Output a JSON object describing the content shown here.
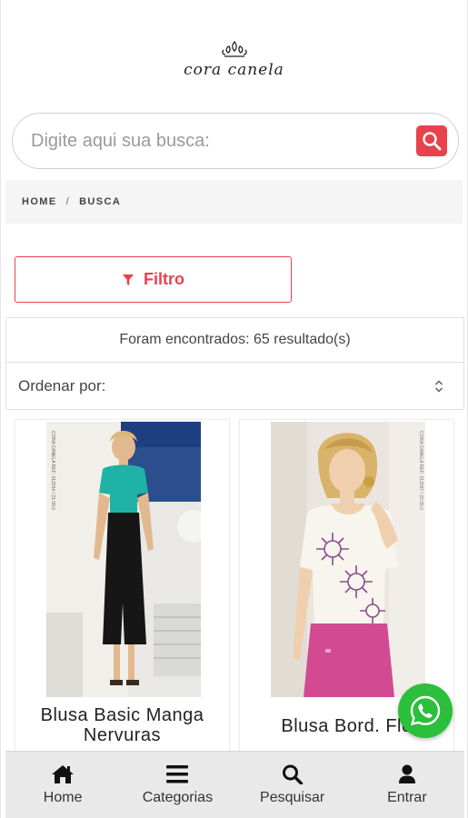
{
  "brand": {
    "logo_text": "cora canela"
  },
  "search": {
    "placeholder": "Digite aqui sua busca:"
  },
  "breadcrumb": {
    "home": "HOME",
    "separator": "/",
    "current": "BUSCA"
  },
  "filter": {
    "label": "Filtro"
  },
  "results": {
    "text": "Foram encontrados: 65 resultado(s)"
  },
  "sort": {
    "label": "Ordenar por:"
  },
  "products": [
    {
      "title": "Blusa Basic Manga Nervuras",
      "photo_caption": "CORA CANELA REF: 212034 / 21.08.0"
    },
    {
      "title": "Blusa Bord. Flo",
      "photo_caption": "CORA CANELA REF: 212097 / 22.05.0"
    }
  ],
  "bottom_nav": {
    "home": "Home",
    "categories": "Categorias",
    "search": "Pesquisar",
    "login": "Entrar"
  },
  "colors": {
    "accent": "#e8424c",
    "whatsapp": "#2bbf3b",
    "nav_bg": "#e9e9e9"
  }
}
